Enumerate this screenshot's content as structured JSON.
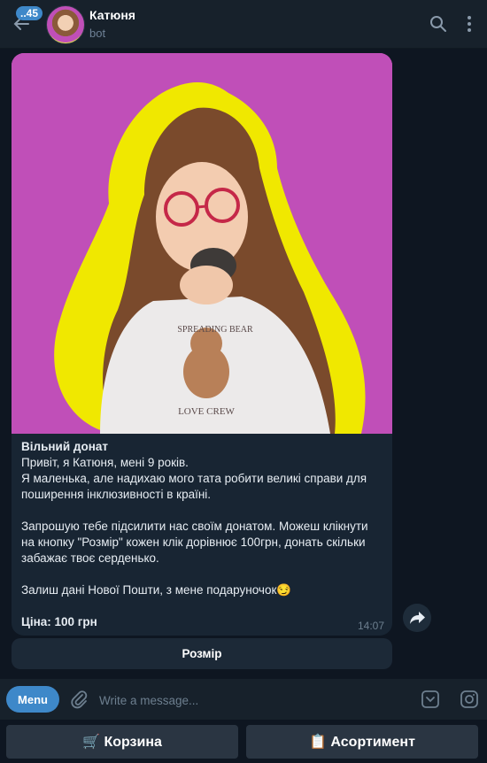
{
  "header": {
    "unread_count": "..45",
    "chat_title": "Катюня",
    "chat_subtitle": "bot",
    "icons": [
      "back-arrow-icon",
      "search-icon",
      "more-vertical-icon"
    ]
  },
  "message": {
    "caption_title": "Вільний донат",
    "caption_lines": [
      "Привіт, я Катюня, мені 9 років.",
      "Я маленька, але надихаю мого тата робити великі справи для поширення інклюзивності в країні."
    ],
    "caption_paragraph2": "Запрошую тебе підсилити нас своїм донатом. Можеш клікнути на кнопку \"Розмір\" кожен клік дорівнює 100грн, донать скільки забажає твоє серденько.",
    "caption_paragraph3": "Залиш дані Нової Пошти, з мене подаруночок😏",
    "price": "Ціна: 100 грн",
    "time": "14:07",
    "inline_button": "Розмір",
    "photo_text_line1": "SPREADING BEAR",
    "photo_text_line2": "LOVE CREW"
  },
  "composer": {
    "menu_label": "Menu",
    "placeholder": "Write a message..."
  },
  "keyboard": {
    "buttons": [
      "🛒 Корзина",
      "📋 Асортимент"
    ]
  },
  "colors": {
    "background": "#0e1621",
    "header": "#17212b",
    "bubble": "#182533",
    "accent": "#3e88c9",
    "photo_bg": "#c04fb8",
    "photo_outline": "#f0e800"
  }
}
